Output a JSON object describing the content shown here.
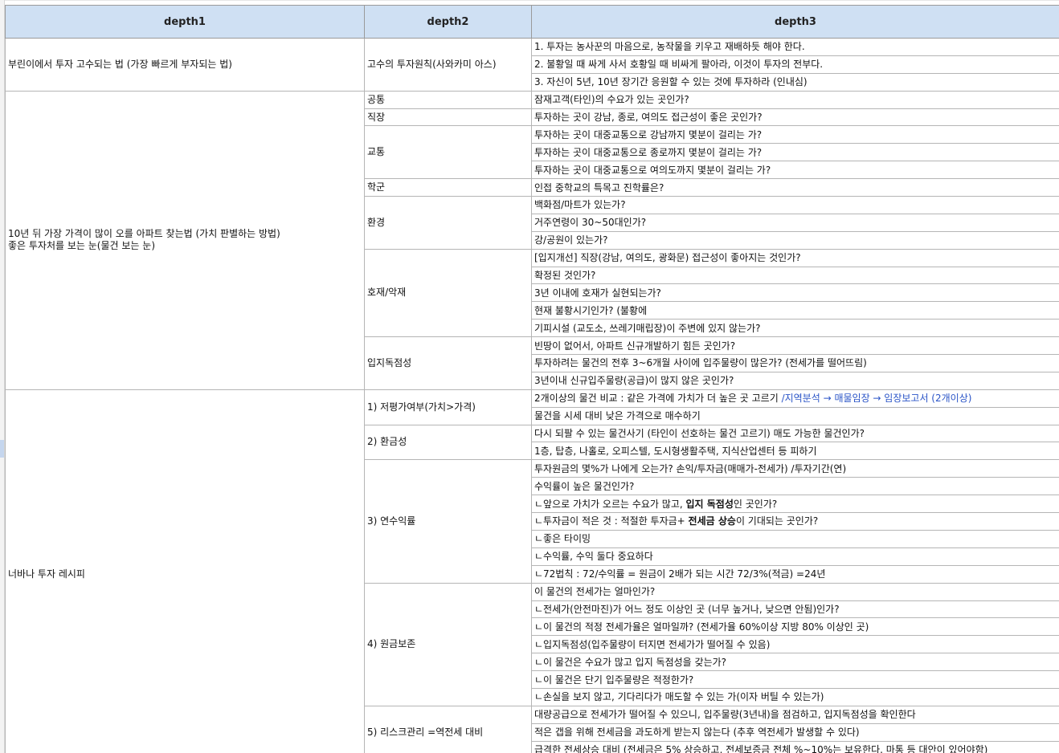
{
  "headers": [
    "depth1",
    "depth2",
    "depth3"
  ],
  "groups": [
    {
      "depth1": [
        "부린이에서 투자 고수되는 법 (가장 빠르게 부자되는 법)"
      ],
      "subs": [
        {
          "depth2": "고수의 투자원칙(사와카미 아스)",
          "items": [
            {
              "parts": [
                {
                  "text": "1. 투자는 농사꾼의 마음으로, 농작물을 키우고 재배하듯 해야 한다."
                }
              ]
            },
            {
              "parts": [
                {
                  "text": "2. 불황일 때 싸게 사서 호황일 때 비싸게 팔아라, 이것이 투자의 전부다."
                }
              ]
            },
            {
              "parts": [
                {
                  "text": "3. 자신이 5년, 10년 장기간 응원할 수 있는 것에 투자하라 (인내심)"
                }
              ]
            }
          ]
        }
      ]
    },
    {
      "depth1": [
        "10년 뒤 가장 가격이 많이 오를 아파트 찾는법 (가치 판별하는 방법)",
        "좋은 투자처를 보는 눈(물건 보는 눈)"
      ],
      "subs": [
        {
          "depth2": "공통",
          "items": [
            {
              "parts": [
                {
                  "text": "잠재고객(타인)의 수요가 있는 곳인가?"
                }
              ]
            }
          ]
        },
        {
          "depth2": "직장",
          "items": [
            {
              "parts": [
                {
                  "text": "투자하는 곳이 강남, 종로, 여의도 접근성이 좋은 곳인가?"
                }
              ]
            }
          ]
        },
        {
          "depth2": "교통",
          "items": [
            {
              "parts": [
                {
                  "text": "투자하는 곳이 대중교통으로 강남까지 몇분이 걸리는 가?"
                }
              ]
            },
            {
              "parts": [
                {
                  "text": "투자하는 곳이 대중교통으로 종로까지 몇분이 걸리는 가?"
                }
              ]
            },
            {
              "parts": [
                {
                  "text": "투자하는 곳이 대중교통으로 여의도까지 몇분이 걸리는 가?"
                }
              ]
            }
          ]
        },
        {
          "depth2": "학군",
          "items": [
            {
              "parts": [
                {
                  "text": "인접 중학교의 특목고 진학률은?"
                }
              ]
            }
          ]
        },
        {
          "depth2": "환경",
          "items": [
            {
              "parts": [
                {
                  "text": "백화점/마트가 있는가?"
                }
              ]
            },
            {
              "parts": [
                {
                  "text": "거주연령이 30~50대인가?"
                }
              ]
            },
            {
              "parts": [
                {
                  "text": "강/공원이 있는가?"
                }
              ]
            }
          ]
        },
        {
          "depth2": "호재/악재",
          "items": [
            {
              "parts": [
                {
                  "text": "[입지개선] 직장(강남, 여의도, 광화문) 접근성이 좋아지는 것인가?"
                }
              ]
            },
            {
              "parts": [
                {
                  "text": "확정된 것인가?"
                }
              ]
            },
            {
              "parts": [
                {
                  "text": "3년 이내에 호재가 실현되는가?"
                }
              ]
            },
            {
              "parts": [
                {
                  "text": "현재 불황시기인가? (불황에"
                }
              ]
            },
            {
              "parts": [
                {
                  "text": "기피시설 (교도소, 쓰레기매립장)이 주변에 있지 않는가?"
                }
              ]
            }
          ]
        },
        {
          "depth2": "입지독점성",
          "items": [
            {
              "parts": [
                {
                  "text": "빈땅이 없어서, 아파트 신규개발하기 힘든 곳인가?"
                }
              ]
            },
            {
              "parts": [
                {
                  "text": "투자하려는 물건의 전후 3~6개월 사이에 입주물량이 많은가? (전세가를 떨어뜨림)"
                }
              ]
            },
            {
              "parts": [
                {
                  "text": "3년이내 신규입주물량(공급)이 많지 않은 곳인가?"
                }
              ]
            }
          ]
        }
      ]
    },
    {
      "depth1": [
        "너바나 투자 레시피"
      ],
      "subs": [
        {
          "depth2": "1) 저평가여부(가치>가격)",
          "items": [
            {
              "parts": [
                {
                  "text": "2개이상의 물건 비교 : 같은 가격에 가치가 더 높은 곳 고르기  "
                },
                {
                  "text": "/지역분석 → 매물임장 → 임장보고서 (2개이상)",
                  "style": "link"
                }
              ]
            },
            {
              "parts": [
                {
                  "text": "물건을 시세 대비 낮은 가격으로 매수하기"
                }
              ]
            }
          ]
        },
        {
          "depth2": "2) 환금성",
          "items": [
            {
              "parts": [
                {
                  "text": "다시 되팔 수 있는 물건사기 (타인이 선호하는 물건 고르기) 매도 가능한 물건인가?"
                }
              ]
            },
            {
              "parts": [
                {
                  "text": "1층, 탑층, 나홀로, 오피스텔, 도시형생활주택, 지식산업센터 등 피하기"
                }
              ]
            }
          ]
        },
        {
          "depth2": "3) 연수익률",
          "items": [
            {
              "parts": [
                {
                  "text": "투자원금의 몇%가 나에게 오는가? 손익/투자금(매매가-전세가) /투자기간(연)"
                }
              ]
            },
            {
              "parts": [
                {
                  "text": "수익률이 높은 물건인가?"
                }
              ]
            },
            {
              "parts": [
                {
                  "text": "ㄴ앞으로 가치가 오르는 수요가 많고, "
                },
                {
                  "text": "입지 독점성",
                  "style": "bold"
                },
                {
                  "text": "인 곳인가?"
                }
              ]
            },
            {
              "parts": [
                {
                  "text": "ㄴ투자금이 적은 것 : 적절한 투자금+ "
                },
                {
                  "text": "전세금 상승",
                  "style": "bold"
                },
                {
                  "text": "이 기대되는 곳인가?"
                }
              ]
            },
            {
              "parts": [
                {
                  "text": "ㄴ좋은 타이밍"
                }
              ]
            },
            {
              "parts": [
                {
                  "text": "ㄴ수익률, 수익 둘다 중요하다"
                }
              ]
            },
            {
              "parts": [
                {
                  "text": "ㄴ72법칙 : 72/수익률 = 원금이 2배가 되는 시간 72/3%(적금) =24년"
                }
              ]
            }
          ]
        },
        {
          "depth2": "4) 원금보존",
          "items": [
            {
              "parts": [
                {
                  "text": "이 물건의 전세가는 얼마인가?"
                }
              ]
            },
            {
              "parts": [
                {
                  "text": "ㄴ전세가(안전마진)가 어느 정도 이상인 곳 (너무 높거나, 낮으면 안됨)인가?"
                }
              ]
            },
            {
              "parts": [
                {
                  "text": "ㄴ이 물건의 적정 전세가율은 얼마일까? (전세가율 60%이상 지방 80% 이상인 곳)"
                }
              ]
            },
            {
              "parts": [
                {
                  "text": "ㄴ입지독점성(입주물량이 터지면 전세가가 떨어질 수 있음)"
                }
              ]
            },
            {
              "parts": [
                {
                  "text": "ㄴ이 물건은 수요가 많고 입지 독점성을 갖는가?"
                }
              ]
            },
            {
              "parts": [
                {
                  "text": "ㄴ이 물건은 단기 입주물량은 적정한가?"
                }
              ]
            },
            {
              "parts": [
                {
                  "text": "ㄴ손실을 보지 않고, 기다리다가 매도할 수 있는 가(이자 버틸 수 있는가)"
                }
              ]
            }
          ]
        },
        {
          "depth2": "5) 리스크관리 =역전세 대비",
          "items": [
            {
              "parts": [
                {
                  "text": "대량공급으로 전세가가 떨어질 수 있으니, 입주물량(3년내)을 점검하고, 입지독점성을 확인한다"
                }
              ]
            },
            {
              "parts": [
                {
                  "text": "적은 갭을 위해 전세금을 과도하게 받는지 않는다 (추후 역전세가 발생할 수 있다)"
                }
              ]
            },
            {
              "parts": [
                {
                  "text": "급격한 전세상승 대비 (전세금은 5% 상승하고, 전세보증금 전체 %~10%는 보유한다. 마통 등 대안이 있어야함)"
                }
              ]
            }
          ]
        }
      ]
    }
  ]
}
